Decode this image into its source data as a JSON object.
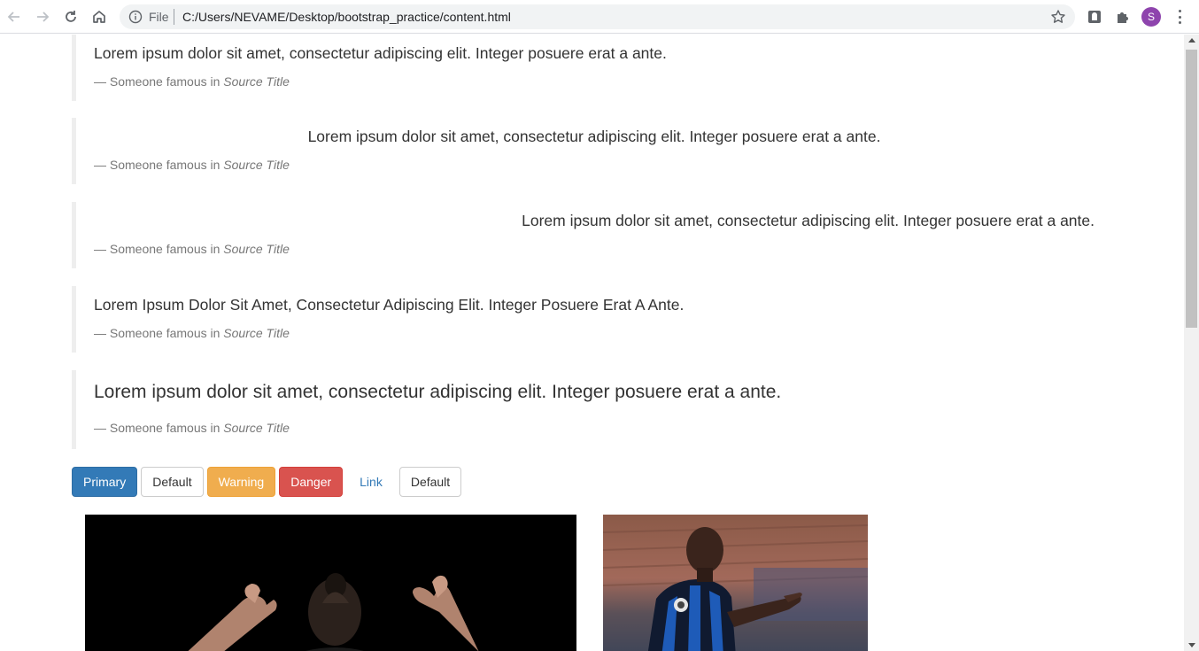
{
  "browser": {
    "omnibox_scheme": "File",
    "url": "C:/Users/NEVAME/Desktop/bootstrap_practice/content.html",
    "profile_initial": "S",
    "icons": [
      "back-arrow-icon",
      "forward-arrow-icon",
      "reload-icon",
      "home-icon",
      "info-icon",
      "star-icon",
      "extension-icon",
      "puzzle-icon",
      "menu-dots-icon"
    ]
  },
  "blockquotes": [
    {
      "text": "Lorem ipsum dolor sit amet, consectetur adipiscing elit. Integer posuere erat a ante.",
      "footer_prefix": "— Someone famous in",
      "source": "Source Title",
      "align": "left"
    },
    {
      "text": "Lorem ipsum dolor sit amet, consectetur adipiscing elit. Integer posuere erat a ante.",
      "footer_prefix": "— Someone famous in",
      "source": "Source Title",
      "align": "center"
    },
    {
      "text": "Lorem ipsum dolor sit amet, consectetur adipiscing elit. Integer posuere erat a ante.",
      "footer_prefix": "— Someone famous in",
      "source": "Source Title",
      "align": "right"
    },
    {
      "text": "Lorem ipsum dolor sit amet, consectetur adipiscing elit. Integer posuere erat a ante.",
      "footer_prefix": "— Someone famous in",
      "source": "Source Title",
      "align": "capitalize"
    },
    {
      "text": "Lorem ipsum dolor sit amet, consectetur adipiscing elit. Integer posuere erat a ante.",
      "footer_prefix": "— Someone famous in",
      "source": "Source Title",
      "align": "lead"
    }
  ],
  "buttons": {
    "primary": "Primary",
    "default1": "Default",
    "warning": "Warning",
    "danger": "Danger",
    "link": "Link",
    "default2": "Default"
  },
  "colors": {
    "primary": "#337ab7",
    "warning": "#f0ad4e",
    "danger": "#d9534f",
    "profile": "#8e44ad"
  }
}
